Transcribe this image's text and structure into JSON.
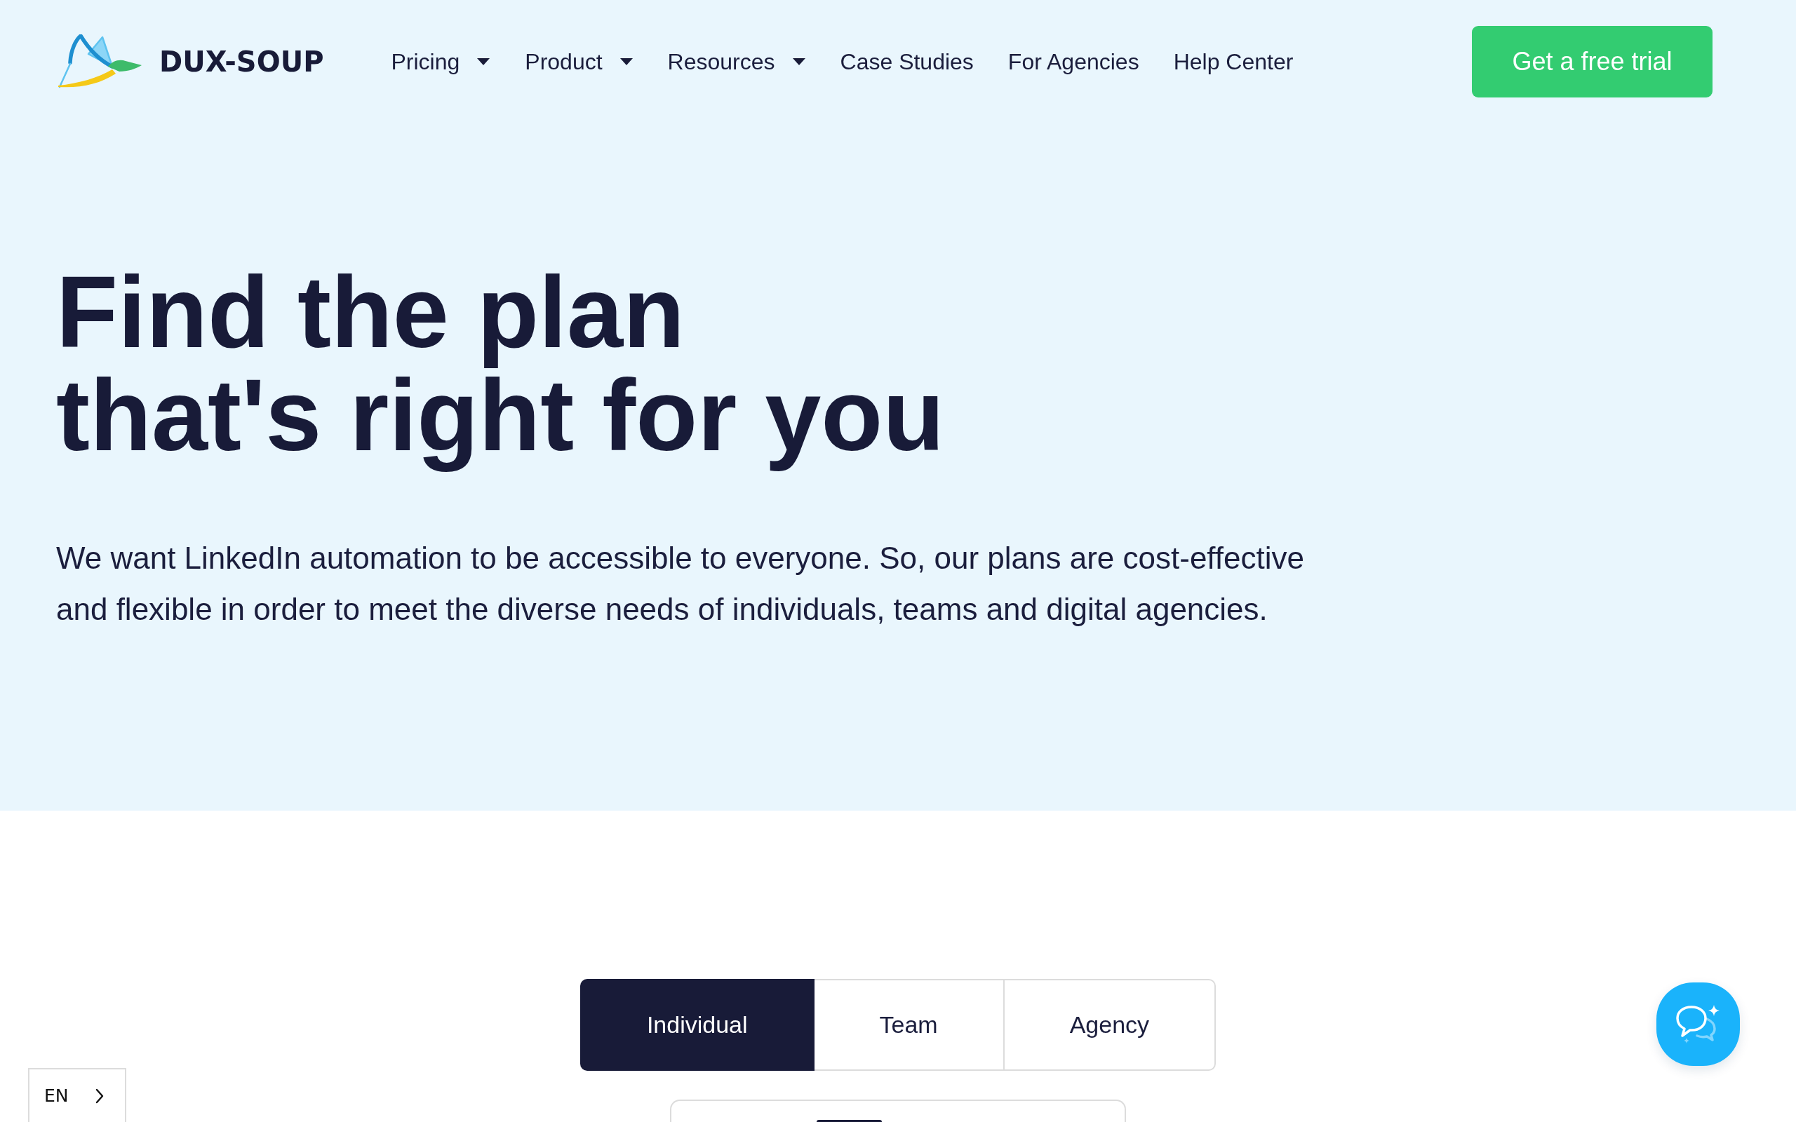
{
  "header": {
    "logo_text": "DUX-SOUP",
    "nav": [
      {
        "label": "Pricing",
        "has_menu": true
      },
      {
        "label": "Product",
        "has_menu": true
      },
      {
        "label": "Resources",
        "has_menu": true
      },
      {
        "label": "Case Studies",
        "has_menu": false
      },
      {
        "label": "For Agencies",
        "has_menu": false
      },
      {
        "label": "Help Center",
        "has_menu": false
      }
    ],
    "cta_button": "Get a free trial"
  },
  "hero": {
    "title": "Find the plan that's right for you",
    "description": "We want LinkedIn automation to be accessible to everyone. So, our plans are cost-effective and flexible in order to meet the diverse needs of individuals, teams and digital agencies."
  },
  "plan_tabs": [
    {
      "label": "Individual",
      "selected": true
    },
    {
      "label": "Team",
      "selected": false
    },
    {
      "label": "Agency",
      "selected": false
    }
  ],
  "language_switcher": {
    "label": "EN"
  }
}
